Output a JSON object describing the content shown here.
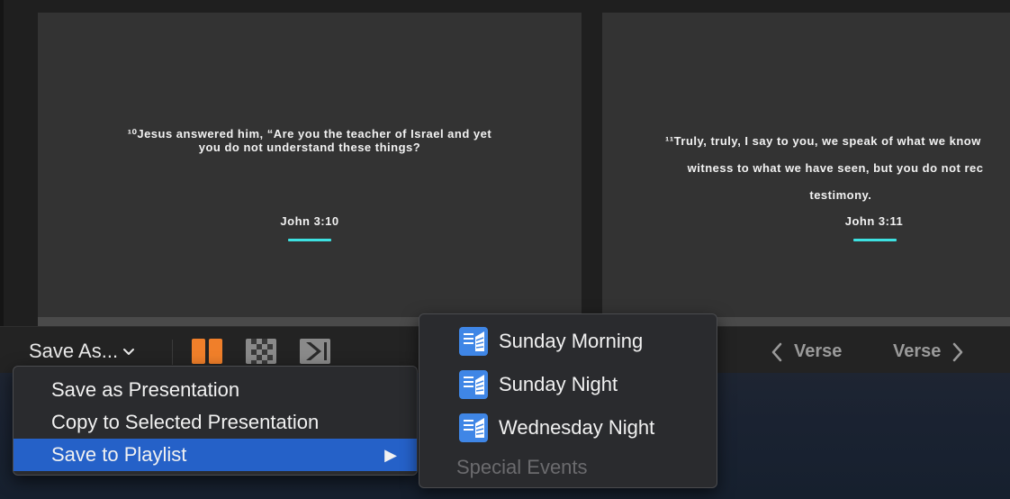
{
  "slides": [
    {
      "text": "¹⁰Jesus answered him, “Are you the teacher of Israel and yet\nyou do not understand these things?",
      "reference": "John 3:10"
    },
    {
      "lines": [
        "¹¹Truly, truly, I say to you, we speak of what we know",
        "      witness to what we have seen, but you do not rec",
        "                                       testimony."
      ],
      "reference": "John 3:11"
    }
  ],
  "toolbar": {
    "save_as_label": "Save As...",
    "icons": [
      "columns-icon",
      "checkerboard-icon",
      "go-live-icon"
    ],
    "nav_prev_label": "Verse",
    "nav_next_label": "Verse"
  },
  "menu": {
    "items": [
      {
        "label": "Save as Presentation"
      },
      {
        "label": "Copy to Selected Presentation"
      },
      {
        "label": "Save to Playlist",
        "has_submenu": true,
        "arrow": "▶"
      }
    ]
  },
  "submenu": {
    "items": [
      {
        "label": "Sunday Morning"
      },
      {
        "label": "Sunday Night"
      },
      {
        "label": "Wednesday Night"
      },
      {
        "label": "Special Events",
        "disabled": true
      }
    ]
  },
  "colors": {
    "accent": "#2561c8",
    "underline": "#3de1e1",
    "orange_icon": "#f07f2a"
  }
}
